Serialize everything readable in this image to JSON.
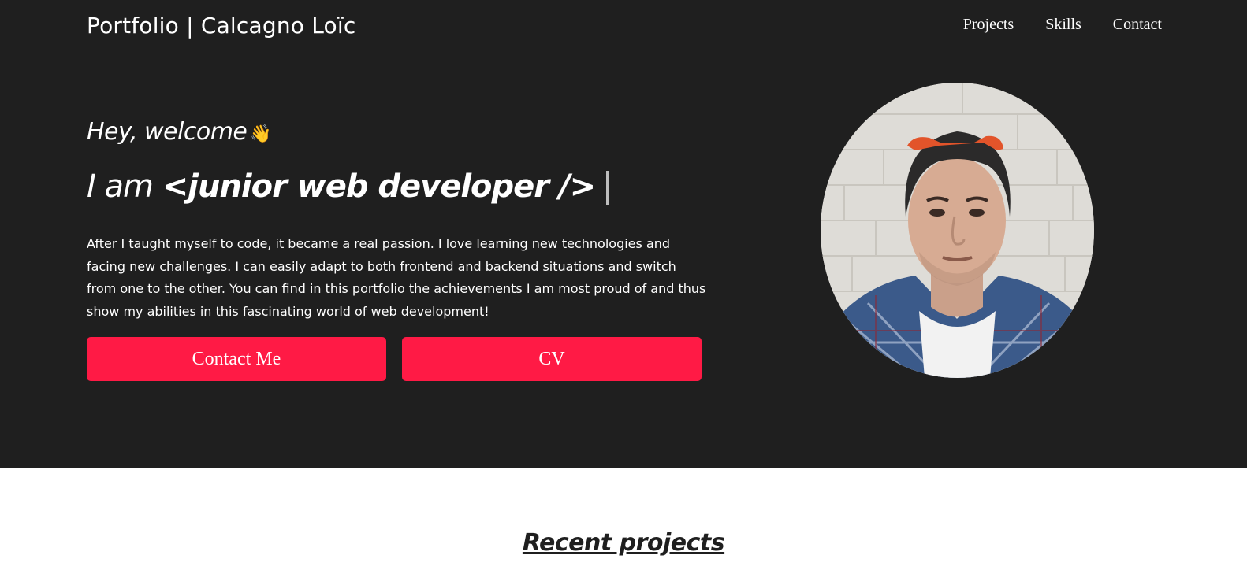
{
  "header": {
    "brand": "Portfolio | Calcagno Loïc",
    "nav": [
      {
        "label": "Projects"
      },
      {
        "label": "Skills"
      },
      {
        "label": "Contact"
      }
    ]
  },
  "hero": {
    "greeting": "Hey, welcome",
    "wave_emoji": "👋",
    "iam_prefix": "I am",
    "role": "<junior web developer />",
    "about": "After I taught myself to code, it became a real passion. I love learning new technologies and facing new challenges. I can easily adapt to both frontend and backend situations and switch from one to the other. You can find in this portfolio the achievements I am most proud of and thus show my abilities in this fascinating world of web development!",
    "buttons": {
      "contact": "Contact Me",
      "cv": "CV"
    }
  },
  "sections": {
    "recent_title": "Recent projects"
  },
  "colors": {
    "hero_bg": "#1f1f1f",
    "accent": "#ff1a45",
    "text_light": "#ffffff",
    "text_dark": "#1f1f1f"
  }
}
